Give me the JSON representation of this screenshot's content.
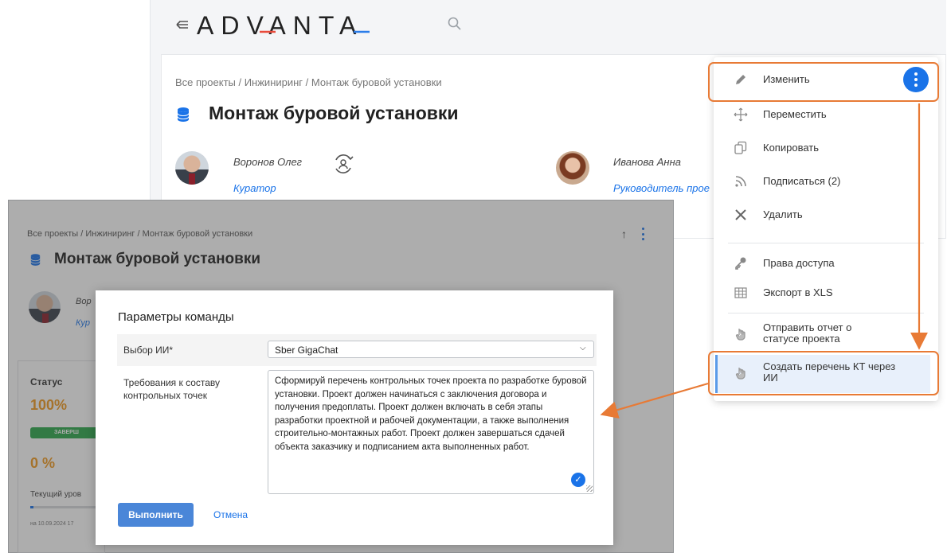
{
  "header": {
    "logo": "ADVANTA",
    "search_icon": "search-icon",
    "menu_icon": "collapse-menu-icon"
  },
  "project": {
    "breadcrumb": "Все проекты / Инжиниринг / Монтаж буровой установки",
    "title": "Монтаж буровой установки",
    "curator": {
      "name": "Воронов Олег",
      "role": "Куратор"
    },
    "manager": {
      "name": "Иванова Анна",
      "role": "Руководитель прое"
    }
  },
  "menu": {
    "items": [
      {
        "label": "Изменить",
        "icon": "pencil-icon"
      },
      {
        "label": "Переместить",
        "icon": "move-icon"
      },
      {
        "label": "Копировать",
        "icon": "copy-icon"
      },
      {
        "label": "Подписаться (2)",
        "icon": "rss-icon"
      },
      {
        "label": "Удалить",
        "icon": "close-icon"
      },
      {
        "label": "Права доступа",
        "icon": "key-icon"
      },
      {
        "label": "Экспорт в XLS",
        "icon": "table-icon"
      },
      {
        "label": "Отправить отчет о статусе проекта",
        "icon": "hand-pointer-icon"
      },
      {
        "label": "Создать перечень КТ через ИИ",
        "icon": "hand-pointer-icon"
      }
    ]
  },
  "front": {
    "breadcrumb": "Все проекты / Инжиниринг / Монтаж буровой установки",
    "title": "Монтаж буровой установки",
    "person_name": "Вор",
    "person_role": "Кур",
    "status": {
      "label": "Статус",
      "percent": "100%",
      "badge": "ЗАВЕРШ",
      "percent2": "0 %",
      "current": "Текущий уров",
      "date": "на 10.09.2024 17"
    }
  },
  "modal": {
    "title": "Параметры команды",
    "ai_label": "Выбор ИИ*",
    "ai_value": "Sber GigaChat",
    "req_label": "Требования к составу контрольных точек",
    "req_text": "Сформируй перечень контрольных точек проекта по разработке буровой установки. Проект должен начинаться с заключения договора и получения предоплаты. Проект должен включать в себя этапы разработки проектной и рабочей документации, а также выполнения строительно-монтажных работ. Проект должен завершаться сдачей объекта заказчику и подписанием акта выполненных работ.",
    "run": "Выполнить",
    "cancel": "Отмена"
  },
  "colors": {
    "accent": "#1a73e8",
    "callout": "#e87a35",
    "status_orange": "#f29a1f",
    "status_green": "#2ca84b"
  }
}
